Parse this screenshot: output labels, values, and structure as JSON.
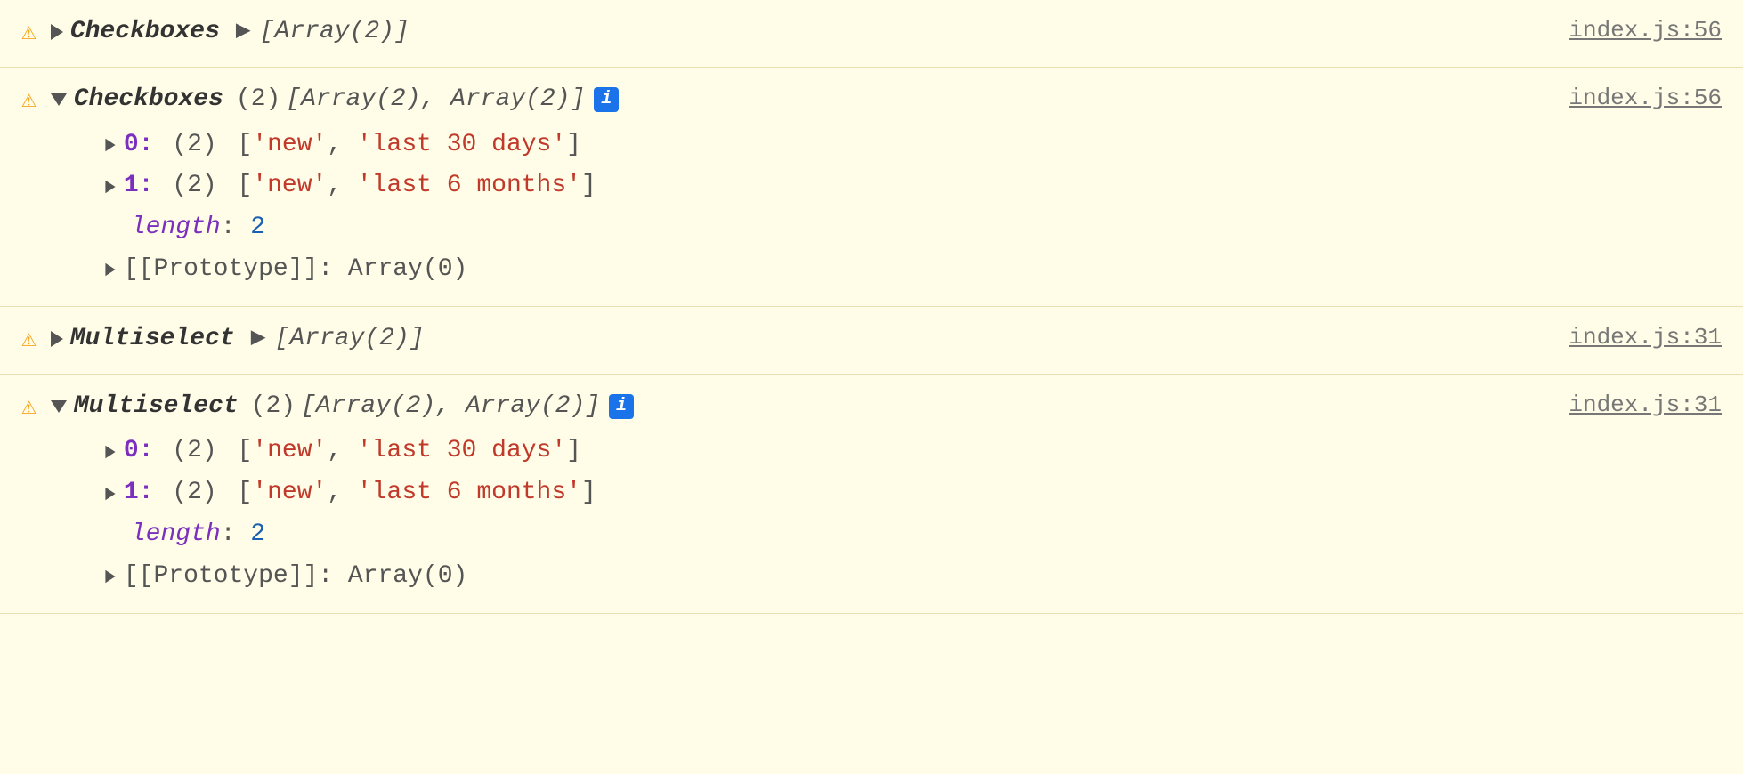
{
  "console": {
    "background": "#fffde7",
    "entries": [
      {
        "id": "entry-1",
        "icon": "⚠",
        "expanded": false,
        "component": "Checkboxes",
        "preview": "[Array(2)]",
        "fileLink": "index.js:56"
      },
      {
        "id": "entry-2",
        "icon": "⚠",
        "expanded": true,
        "component": "Checkboxes",
        "count": "(2)",
        "preview": "[Array(2), Array(2)]",
        "hasInfoBadge": true,
        "items": [
          {
            "index": "0",
            "count": "(2)",
            "values": [
              "'new'",
              "'last 30 days'"
            ]
          },
          {
            "index": "1",
            "count": "(2)",
            "values": [
              "'new'",
              "'last 6 months'"
            ]
          }
        ],
        "length": "2",
        "prototype": "[[Prototype]]: Array(0)",
        "fileLink": "index.js:56"
      },
      {
        "id": "entry-3",
        "icon": "⚠",
        "expanded": false,
        "component": "Multiselect",
        "preview": "[Array(2)]",
        "fileLink": "index.js:31"
      },
      {
        "id": "entry-4",
        "icon": "⚠",
        "expanded": true,
        "component": "Multiselect",
        "count": "(2)",
        "preview": "[Array(2), Array(2)]",
        "hasInfoBadge": true,
        "items": [
          {
            "index": "0",
            "count": "(2)",
            "values": [
              "'new'",
              "'last 30 days'"
            ]
          },
          {
            "index": "1",
            "count": "(2)",
            "values": [
              "'new'",
              "'last 6 months'"
            ]
          }
        ],
        "length": "2",
        "prototype": "[[Prototype]]: Array(0)",
        "fileLink": "index.js:31"
      }
    ]
  }
}
